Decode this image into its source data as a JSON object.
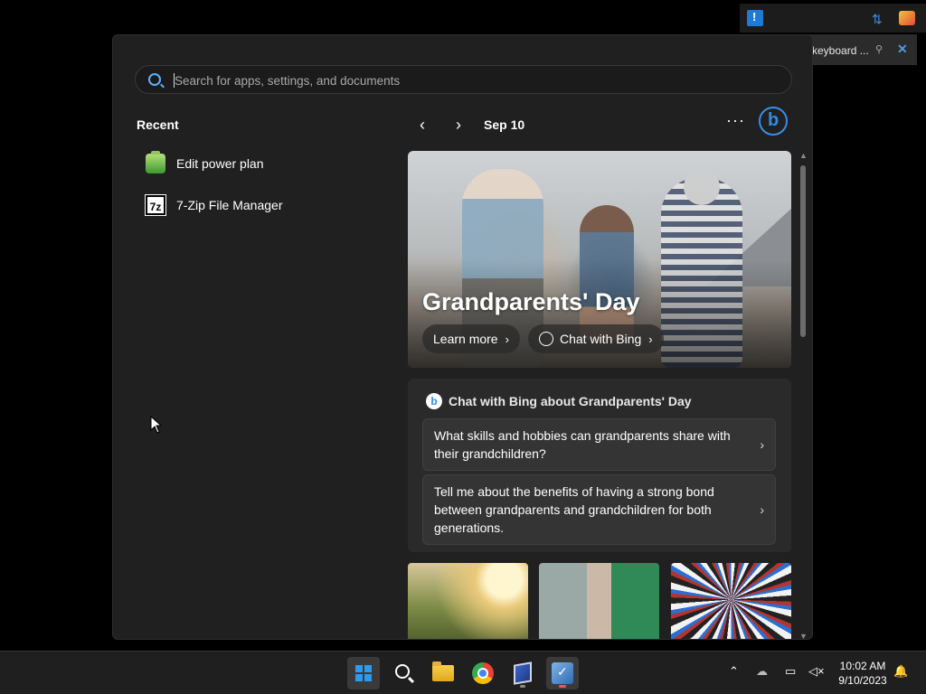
{
  "search": {
    "placeholder": "Search for apps, settings, and documents"
  },
  "recent": {
    "title": "Recent",
    "items": [
      {
        "label": "Edit power plan",
        "icon": "battery-icon"
      },
      {
        "label": "7-Zip File Manager",
        "icon": "7zip-icon",
        "badge": "7z"
      }
    ]
  },
  "widgets": {
    "date": "Sep 10",
    "hero": {
      "title": "Grandparents' Day",
      "learn_more": "Learn more",
      "chat_with_bing": "Chat with Bing"
    },
    "bing_card": {
      "header": "Chat with Bing about Grandparents' Day",
      "questions": [
        "What skills and hobbies can grandparents share with their grandchildren?",
        "Tell me about the benefits of having a strong bond between grandparents and grandchildren for both generations."
      ]
    }
  },
  "notification": {
    "text": "keyboard ..."
  },
  "taskbar": {
    "apps": [
      "start",
      "search",
      "file-explorer",
      "chrome",
      "virtualbox",
      "app"
    ],
    "clock": {
      "time": "10:02 AM",
      "date": "9/10/2023"
    }
  },
  "colors": {
    "accent": "#2b9bf2",
    "bing": "#2f8de4",
    "panel": "#202020"
  }
}
